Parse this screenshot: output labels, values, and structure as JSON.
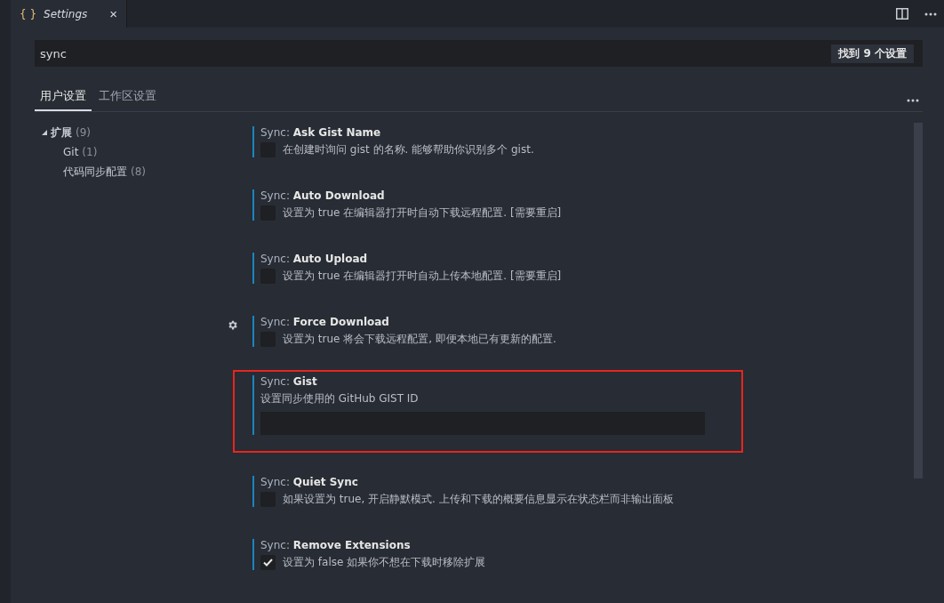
{
  "editor_tab": {
    "icon": "{ }",
    "title": "Settings",
    "close": "×"
  },
  "search": {
    "value": "sync",
    "result_count": "找到 9 个设置"
  },
  "settings_tabs": [
    {
      "label": "用户设置",
      "selected": true
    },
    {
      "label": "工作区设置",
      "selected": false
    }
  ],
  "tree": [
    {
      "label": "扩展",
      "count": "(9)",
      "expanded": true,
      "children": [
        {
          "label": "Git",
          "count": "(1)"
        },
        {
          "label": "代码同步配置",
          "count": "(8)"
        }
      ]
    }
  ],
  "settings": [
    {
      "kind": "checkbox",
      "prefix": "Sync: ",
      "name": "Ask Gist Name",
      "description": "在创建时询问 gist 的名称. 能够帮助你识别多个 gist.",
      "checked": false,
      "gear": false,
      "highlighted": false
    },
    {
      "kind": "checkbox",
      "prefix": "Sync: ",
      "name": "Auto Download",
      "description": "设置为 true 在编辑器打开时自动下载远程配置. [需要重启]",
      "checked": false,
      "gear": false,
      "highlighted": false
    },
    {
      "kind": "checkbox",
      "prefix": "Sync: ",
      "name": "Auto Upload",
      "description": "设置为 true 在编辑器打开时自动上传本地配置. [需要重启]",
      "checked": false,
      "gear": false,
      "highlighted": false
    },
    {
      "kind": "checkbox",
      "prefix": "Sync: ",
      "name": "Force Download",
      "description": "设置为 true 将会下载远程配置, 即便本地已有更新的配置.",
      "checked": false,
      "gear": true,
      "highlighted": false
    },
    {
      "kind": "text",
      "prefix": "Sync: ",
      "name": "Gist",
      "description": "设置同步使用的 GitHub GIST ID",
      "gear": false,
      "highlighted": true
    },
    {
      "kind": "checkbox",
      "prefix": "Sync: ",
      "name": "Quiet Sync",
      "description": "如果设置为 true, 开启静默模式. 上传和下载的概要信息显示在状态栏而非输出面板",
      "checked": false,
      "gear": false,
      "highlighted": false
    },
    {
      "kind": "checkbox",
      "prefix": "Sync: ",
      "name": "Remove Extensions",
      "description": "设置为 false 如果你不想在下载时移除扩展",
      "checked": true,
      "gear": false,
      "highlighted": false
    }
  ]
}
